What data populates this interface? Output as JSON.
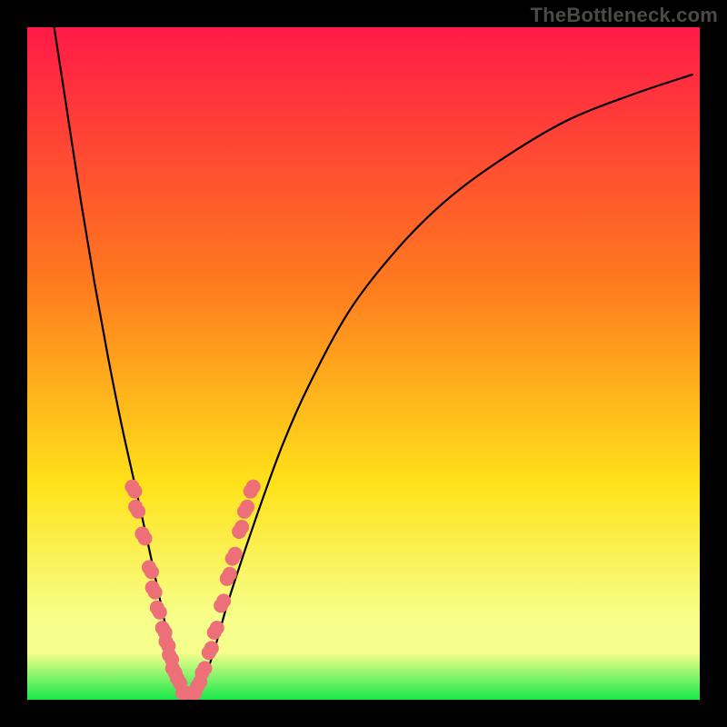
{
  "watermark": "TheBottleneck.com",
  "colors": {
    "frame": "#000000",
    "gradient_top": "#ff1a47",
    "gradient_mid1": "#ff7a1e",
    "gradient_mid2": "#ffe21a",
    "gradient_low": "#f6ff8c",
    "gradient_bottom": "#17e84a",
    "curve": "#000000",
    "marker": "#ed6f78"
  },
  "chart_data": {
    "type": "line",
    "title": "",
    "xlabel": "",
    "ylabel": "",
    "xlim": [
      0,
      100
    ],
    "ylim": [
      0,
      100
    ],
    "series": [
      {
        "name": "bottleneck-curve",
        "x": [
          4,
          6,
          8,
          10,
          12,
          14,
          16,
          18,
          19.5,
          21,
          22.5,
          24,
          27,
          30,
          34,
          38,
          42,
          48,
          55,
          62,
          70,
          80,
          90,
          99
        ],
        "y": [
          100,
          87,
          74,
          62,
          51,
          41,
          32,
          23,
          16,
          9,
          3,
          0,
          5,
          15,
          27,
          38,
          47,
          58,
          67,
          74,
          80,
          86,
          90,
          93
        ]
      }
    ],
    "markers": [
      {
        "x": 16.0,
        "y": 31
      },
      {
        "x": 16.5,
        "y": 28
      },
      {
        "x": 17.5,
        "y": 24
      },
      {
        "x": 18.5,
        "y": 19
      },
      {
        "x": 19.0,
        "y": 16
      },
      {
        "x": 19.7,
        "y": 13
      },
      {
        "x": 20.5,
        "y": 10
      },
      {
        "x": 21.0,
        "y": 8
      },
      {
        "x": 21.5,
        "y": 6
      },
      {
        "x": 22.0,
        "y": 4
      },
      {
        "x": 22.7,
        "y": 2.5
      },
      {
        "x": 23.5,
        "y": 1
      },
      {
        "x": 24.5,
        "y": 1
      },
      {
        "x": 25.3,
        "y": 2
      },
      {
        "x": 26.0,
        "y": 4
      },
      {
        "x": 27.0,
        "y": 7
      },
      {
        "x": 27.8,
        "y": 10
      },
      {
        "x": 28.8,
        "y": 14
      },
      {
        "x": 29.7,
        "y": 18
      },
      {
        "x": 30.5,
        "y": 21
      },
      {
        "x": 31.5,
        "y": 25
      },
      {
        "x": 32.3,
        "y": 28
      },
      {
        "x": 33.2,
        "y": 31
      }
    ],
    "legend": null,
    "grid": false,
    "vertex_x": 24
  }
}
